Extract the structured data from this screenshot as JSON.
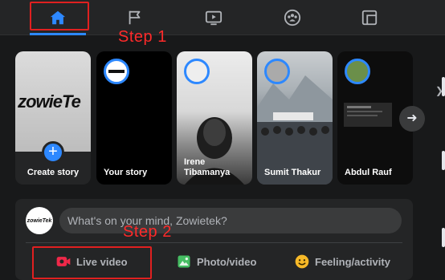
{
  "nav": {
    "tabs": [
      {
        "name": "home",
        "active": true
      },
      {
        "name": "pages",
        "active": false
      },
      {
        "name": "watch",
        "active": false
      },
      {
        "name": "groups",
        "active": false
      },
      {
        "name": "gaming",
        "active": false
      }
    ],
    "accent": "#2d88ff"
  },
  "annotations": {
    "step1": "Step 1",
    "step2": "Step 2",
    "color": "#ff2a2a"
  },
  "stories": {
    "create": {
      "label": "Create story",
      "brand_text": "zowieTe"
    },
    "items": [
      {
        "label": "Your story"
      },
      {
        "label": "Irene Tibamanya"
      },
      {
        "label": "Sumit Thakur"
      },
      {
        "label": "Abdul Rauf"
      }
    ]
  },
  "composer": {
    "avatar_text": "zowieTek",
    "placeholder": "What's on your mind, Zowietek?",
    "actions": [
      {
        "label": "Live video",
        "icon": "live-video-icon",
        "color": "#f02849"
      },
      {
        "label": "Photo/video",
        "icon": "photo-icon",
        "color": "#45bd62"
      },
      {
        "label": "Feeling/activity",
        "icon": "feeling-icon",
        "color": "#f7b928"
      }
    ]
  }
}
